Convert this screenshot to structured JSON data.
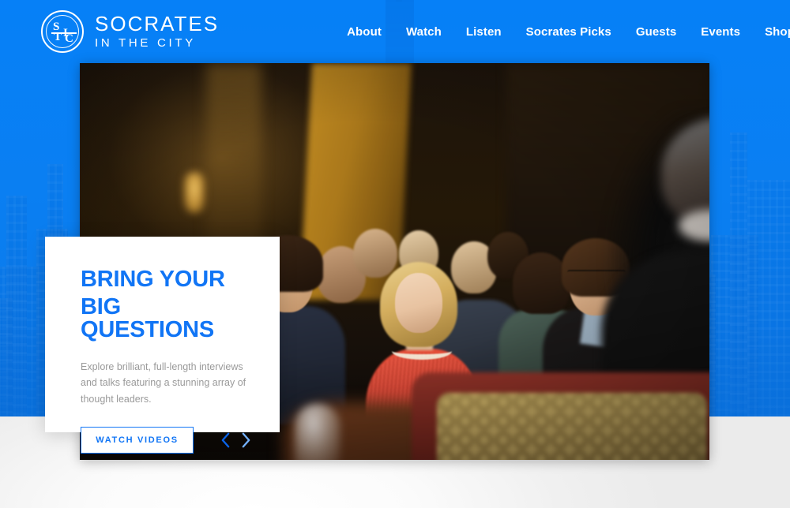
{
  "brand": {
    "logo_icon": "stc-monogram-icon",
    "logo_letters": {
      "s": "S",
      "i": "I",
      "t": "T",
      "c": "C"
    },
    "name_line1": "SOCRATES",
    "name_line2": "IN THE CITY"
  },
  "nav": {
    "items": [
      {
        "label": "About",
        "name": "nav-item-about"
      },
      {
        "label": "Watch",
        "name": "nav-item-watch"
      },
      {
        "label": "Listen",
        "name": "nav-item-listen"
      },
      {
        "label": "Socrates Picks",
        "name": "nav-item-socrates-picks"
      },
      {
        "label": "Guests",
        "name": "nav-item-guests"
      },
      {
        "label": "Events",
        "name": "nav-item-events"
      },
      {
        "label": "Shop",
        "name": "nav-item-shop"
      }
    ],
    "search_icon": "search-icon"
  },
  "hero": {
    "image_alt": "Audience seated in an ornate hall listening to a speaker",
    "card": {
      "title_line1": "BRING YOUR",
      "title_line2": "BIG QUESTIONS",
      "description": "Explore brilliant, full-length interviews and talks featuring a stunning array of thought leaders.",
      "cta_label": "WATCH VIDEOS",
      "prev_icon": "chevron-left-icon",
      "next_icon": "chevron-right-icon"
    }
  },
  "colors": {
    "brand_blue": "#0680f7",
    "accent_blue": "#1175f5",
    "arrow_active": "#0a63e8",
    "arrow_inactive": "#74b1fb",
    "text_muted": "#9a9a9a",
    "card_bg": "#ffffff"
  }
}
